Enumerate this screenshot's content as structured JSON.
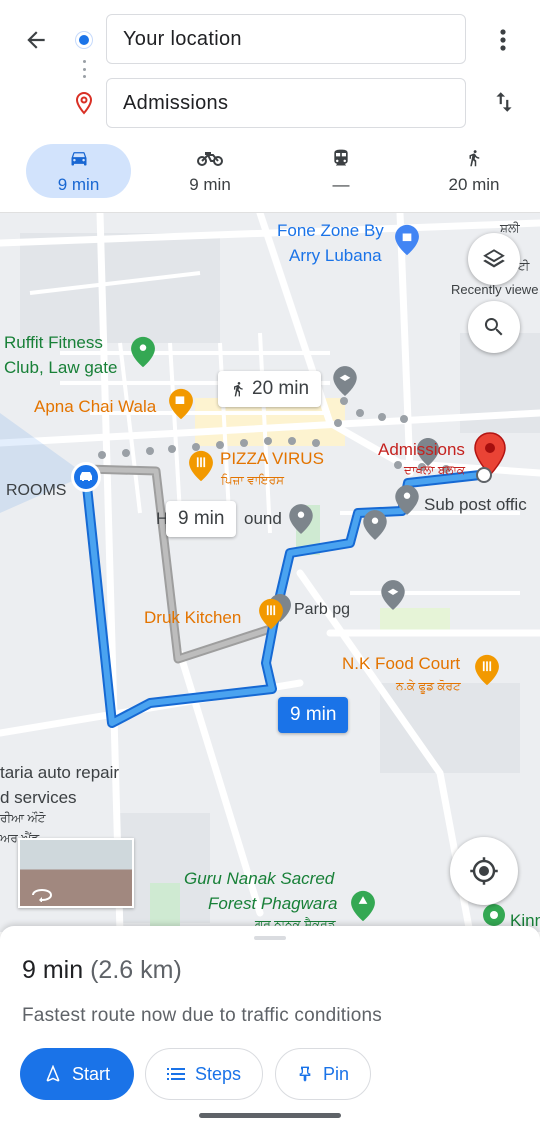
{
  "search": {
    "origin": "Your location",
    "destination": "Admissions"
  },
  "travel_modes": [
    {
      "mode": "driving",
      "icon": "car-icon",
      "time": "9 min",
      "active": true
    },
    {
      "mode": "motorcycle",
      "icon": "motorcycle-icon",
      "time": "9 min",
      "active": false
    },
    {
      "mode": "transit",
      "icon": "train-icon",
      "time": "—",
      "active": false
    },
    {
      "mode": "walking",
      "icon": "walk-icon",
      "time": "20 min",
      "active": false
    }
  ],
  "map": {
    "labels": {
      "fone_zone": "Fone Zone By",
      "arry_lubana": "Arry Lubana",
      "ruffit": "Ruffit Fitness",
      "club_law_gate": "Club, Law gate",
      "apna_chai": "Apna Chai Wala",
      "pizza_virus": "PIZZA VIRUS",
      "pizza_virus_pa": "ਪਿਜ਼ਾ ਵਾਇਰਸ",
      "rooms": "ROOMS",
      "admissions": "Admissions",
      "admissions_pa": "ਦਾਖਲਾ ਬਲਾਕ",
      "sub_post": "Sub post offic",
      "h_round": "H",
      "h_round_suffix": "ound",
      "druk_kitchen": "Druk Kitchen",
      "parb_pg": "Parb pg",
      "nk_food": "N.K Food Court",
      "nk_food_pa": "ਨ.ਕੇ ਫੂਡ ਕੋਰਟ",
      "auto_repair": "taria auto repair",
      "d_services": "d services",
      "auto_pa": "ਰੀਆ ਔਟੋ",
      "auto_pa2": "ਅਰ ਐਂਡ",
      "guru_nanak": "Guru Nanak Sacred",
      "forest": "Forest Phagwara",
      "forest_pa": "ਗੁਰੂ ਨਾਨਕ ਸੈਕਰਡ",
      "kinn": "Kinn",
      "recently_viewed": "Recently viewe",
      "top_right_pa1": "ਸ਼ਲੀ",
      "top_right_pa2": "ਟੀ"
    },
    "chips": {
      "walk_time": "20 min",
      "alt_route_time": "9 min",
      "main_route_time": "9 min"
    }
  },
  "sheet": {
    "duration": "9 min",
    "distance": "(2.6 km)",
    "reason": "Fastest route now due to traffic conditions",
    "buttons": {
      "start": "Start",
      "steps": "Steps",
      "pin": "Pin"
    }
  },
  "colors": {
    "primary": "#1a73e8",
    "route_main": "#4aa3f0",
    "route_alt": "#a8a8a8",
    "destination_pin": "#ea4335",
    "mode_active_bg": "#d2e3fc"
  }
}
